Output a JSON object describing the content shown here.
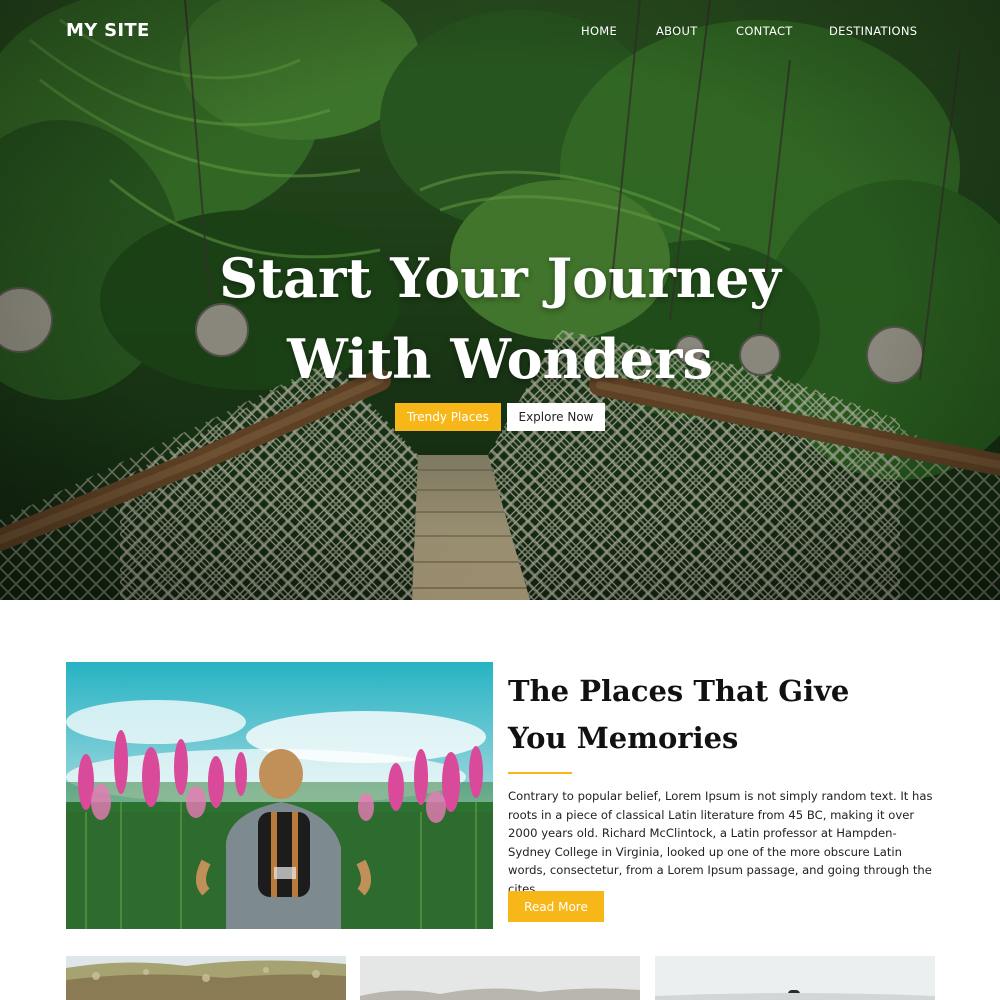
{
  "site": {
    "brand": "MY SITE"
  },
  "nav": {
    "items": [
      {
        "label": "HOME"
      },
      {
        "label": "ABOUT"
      },
      {
        "label": "CONTACT"
      },
      {
        "label": "DESTINATIONS"
      }
    ]
  },
  "hero": {
    "title_line1": "Start Your Journey",
    "title_line2": "With Wonders",
    "primary_button": "Trendy Places",
    "secondary_button": "Explore Now"
  },
  "feature": {
    "heading_line1": "The Places That Give",
    "heading_line2": "You Memories",
    "body": "Contrary to popular belief, Lorem Ipsum is not simply random text. It has roots in a piece of classical Latin literature from 45 BC, making it over 2000 years old. Richard McClintock, a Latin professor at Hampden-Sydney College in Virginia, looked up one of the more obscure Latin words, consectetur, from a Lorem Ipsum passage, and going through the cites",
    "button": "Read More"
  },
  "colors": {
    "accent": "#f7b719",
    "text_dark": "#111111",
    "white": "#ffffff"
  }
}
